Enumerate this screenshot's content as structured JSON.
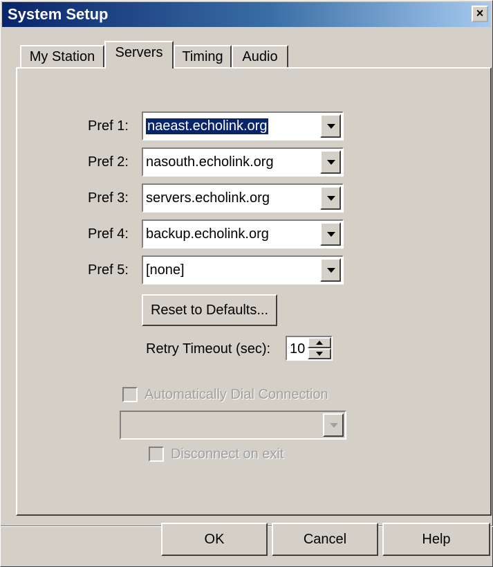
{
  "window": {
    "title": "System Setup",
    "close_glyph": "×"
  },
  "tabs": [
    {
      "label": "My Station"
    },
    {
      "label": "Servers"
    },
    {
      "label": "Timing"
    },
    {
      "label": "Audio"
    }
  ],
  "servers": [
    {
      "label": "Pref 1:",
      "value": "naeast.echolink.org"
    },
    {
      "label": "Pref 2:",
      "value": "nasouth.echolink.org"
    },
    {
      "label": "Pref 3:",
      "value": "servers.echolink.org"
    },
    {
      "label": "Pref 4:",
      "value": "backup.echolink.org"
    },
    {
      "label": "Pref 5:",
      "value": "[none]"
    }
  ],
  "reset_button": "Reset to Defaults...",
  "retry": {
    "label": "Retry Timeout (sec):",
    "value": "10"
  },
  "auto_dial": {
    "label": "Automatically Dial Connection",
    "checked": false,
    "enabled": false,
    "value": ""
  },
  "disconnect": {
    "label": "Disconnect on exit",
    "checked": false,
    "enabled": false
  },
  "footer": {
    "ok": "OK",
    "cancel": "Cancel",
    "help": "Help"
  },
  "colors": {
    "dialog_bg": "#d4d0c8",
    "title_start": "#0a246a",
    "selection": "#0a246a"
  }
}
